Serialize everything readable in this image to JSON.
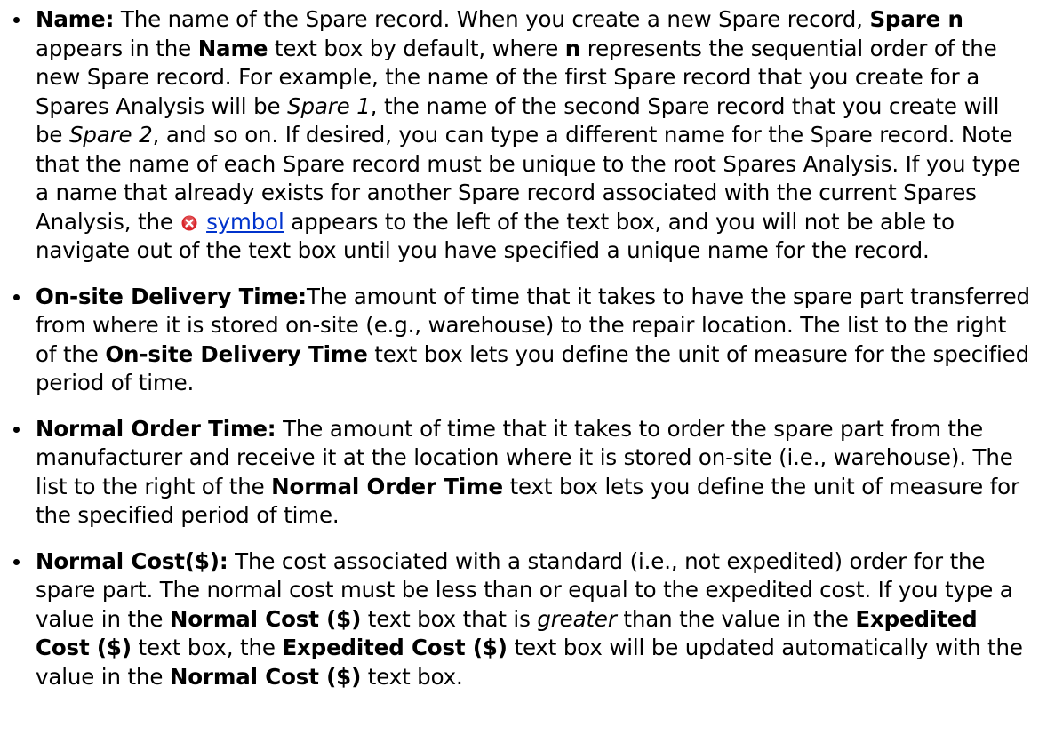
{
  "items": [
    {
      "term": "Name:",
      "segments": [
        " The name of the Spare record. When you create a new Spare record, ",
        {
          "b": "Spare n"
        },
        " appears in the ",
        {
          "b": "Name"
        },
        " text box by default, where ",
        {
          "b": "n"
        },
        " represents the sequential order of the new Spare record. For example, the name of the first Spare record that you create for a Spares Analysis will be ",
        {
          "i": "Spare 1"
        },
        ", the name of the second Spare record that you create will be ",
        {
          "i": "Spare 2"
        },
        ", and so on. If desired, you can type a dif­ferent name for the Spare record. Note that the name of each Spare record must be unique to the root Spares Analysis. If you type a name that already exists for another Spare record associated with the current Spares Analysis, the ",
        {
          "icon": "error-x-icon"
        },
        " ",
        {
          "link": "symbol"
        },
        " appears to the left of the text box, and you will not be able to navigate out of the text box until you have specified a unique name for the record."
      ]
    },
    {
      "term": "On-site Delivery Time:",
      "segments": [
        "The amount of time that it takes to have the spare part transferred from where it is stored on-site (e.g., warehouse) to the repair location. The list to the right of the ",
        {
          "b": "On-site Delivery Time"
        },
        " text box lets you define the unit of measure for the specified period of time."
      ]
    },
    {
      "term": "Normal Order Time:",
      "segments": [
        " The amount of time that it takes to order the spare part from the manufacturer and receive it at the location where it is stored on-site (i.e., ware­house). The list to the right of the ",
        {
          "b": "Normal Order Time"
        },
        " text box lets you define the unit of measure for the specified period of time."
      ]
    },
    {
      "term": "Normal Cost($):",
      "segments": [
        " The cost associated with a standard (i.e., not expedited) order for the spare part. The normal cost must be less than or equal to the expedited cost. If you type a value in the ",
        {
          "b": "Normal Cost ($)"
        },
        " text box that is ",
        {
          "i": "greater"
        },
        " than the value in the ",
        {
          "b": "Expedited Cost ($)"
        },
        " text box, the ",
        {
          "b": "Expedited Cost ($)"
        },
        " text box will be updated automatically with the value in the ",
        {
          "b": "Normal Cost ($)"
        },
        " text box."
      ]
    }
  ],
  "colors": {
    "text": "#000000",
    "link": "#0033cc",
    "error_icon": "#d9262b"
  }
}
